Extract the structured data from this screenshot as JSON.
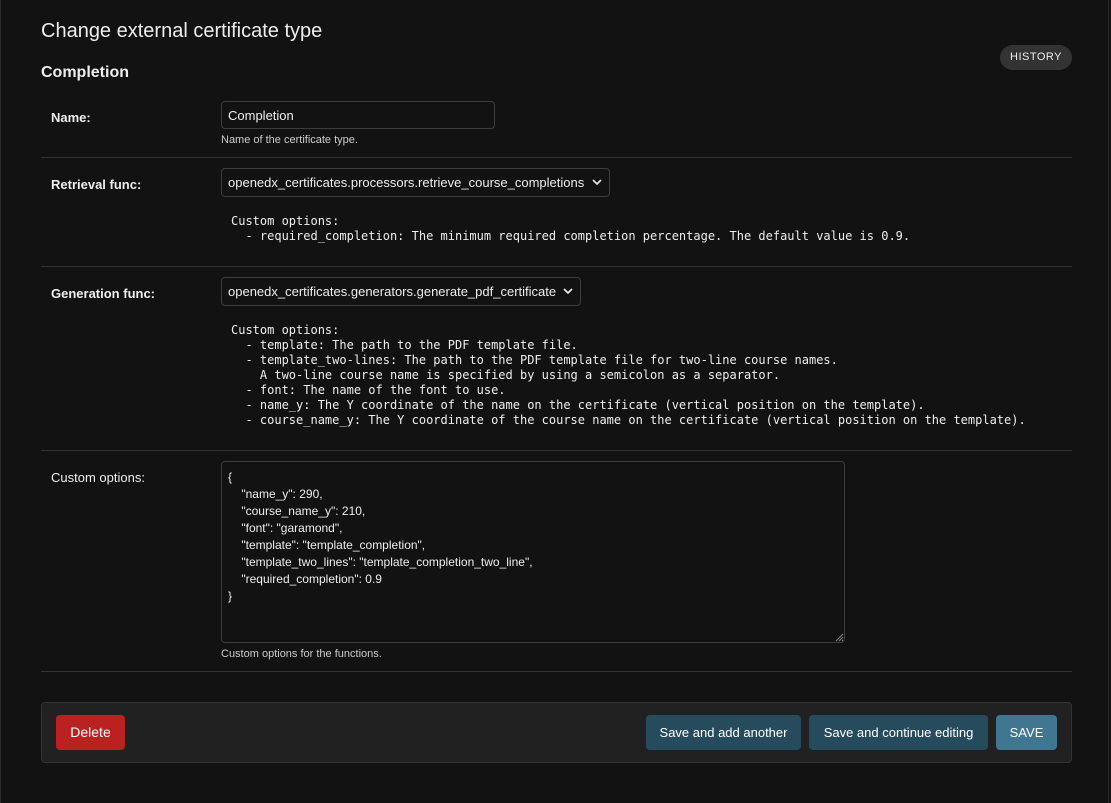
{
  "header": {
    "title": "Change external certificate type",
    "history_label": "HISTORY"
  },
  "fieldset": {
    "title": "Completion"
  },
  "fields": {
    "name": {
      "label": "Name:",
      "value": "Completion",
      "help": "Name of the certificate type."
    },
    "retrieval_func": {
      "label": "Retrieval func:",
      "selected": "openedx_certificates.processors.retrieve_course_completions",
      "description": "Custom options:\n  - required_completion: The minimum required completion percentage. The default value is 0.9."
    },
    "generation_func": {
      "label": "Generation func:",
      "selected": "openedx_certificates.generators.generate_pdf_certificate",
      "description": "Custom options:\n  - template: The path to the PDF template file.\n  - template_two-lines: The path to the PDF template file for two-line course names.\n    A two-line course name is specified by using a semicolon as a separator.\n  - font: The name of the font to use.\n  - name_y: The Y coordinate of the name on the certificate (vertical position on the template).\n  - course_name_y: The Y coordinate of the course name on the certificate (vertical position on the template)."
    },
    "custom_options": {
      "label": "Custom options:",
      "value": "{\n    \"name_y\": 290,\n    \"course_name_y\": 210,\n    \"font\": \"garamond\",\n    \"template\": \"template_completion\",\n    \"template_two_lines\": \"template_completion_two_line\",\n    \"required_completion\": 0.9\n}",
      "help": "Custom options for the functions."
    }
  },
  "actions": {
    "delete_label": "Delete",
    "save_add_label": "Save and add another",
    "save_continue_label": "Save and continue editing",
    "save_label": "SAVE"
  },
  "colors": {
    "background": "#121212",
    "delete": "#ba2121",
    "secondary_button": "#264b5d",
    "primary_button": "#417690"
  },
  "icons": {
    "select_arrow": "chevron-down-icon",
    "textarea_resize": "resize-grip-icon"
  }
}
